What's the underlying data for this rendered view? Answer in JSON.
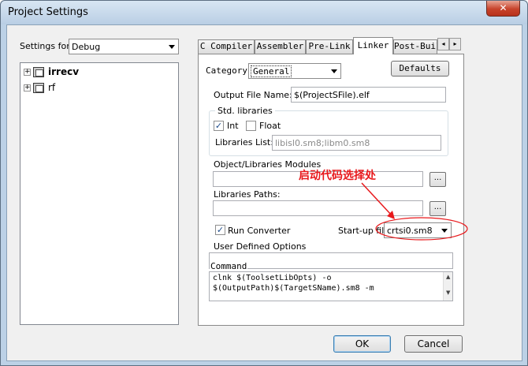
{
  "window": {
    "title": "Project Settings",
    "close_glyph": "✕"
  },
  "settings_for": {
    "label": "Settings for:",
    "value": "Debug"
  },
  "tree": {
    "items": [
      {
        "label": "irrecv",
        "expander": "+"
      },
      {
        "label": "rf",
        "expander": "+"
      }
    ]
  },
  "tabs": [
    {
      "label": "C Compiler"
    },
    {
      "label": "Assembler"
    },
    {
      "label": "Pre-Link"
    },
    {
      "label": "Linker"
    },
    {
      "label": "Post-Buil"
    }
  ],
  "tab_scroll": {
    "left": "◂",
    "right": "▸"
  },
  "linker": {
    "category_label": "Category",
    "category_value": "General",
    "defaults_button": "Defaults",
    "output_file_label": "Output File Name:",
    "output_file_value": "$(ProjectSFile).elf",
    "std_libraries_legend": "Std. libraries",
    "int_label": "Int",
    "int_checked": "✓",
    "float_label": "Float",
    "libraries_list_label": "Libraries List:",
    "libraries_list_value": "libisl0.sm8;libm0.sm8",
    "object_modules_label": "Object/Libraries Modules",
    "ellipsis_1": "...",
    "libraries_paths_label": "Libraries Paths:",
    "ellipsis_2": "...",
    "run_converter_label": "Run Converter",
    "run_converter_checked": "✓",
    "startup_file_label": "Start-up file:",
    "startup_file_value": "crtsi0.sm8",
    "user_options_label": "User Defined Options",
    "command_label": "Command",
    "command_lines": [
      "clnk $(ToolsetLibOpts) -o",
      "$(OutputPath)$(TargetSName).sm8 -m"
    ]
  },
  "annotation": {
    "text": "启动代码选择处",
    "color": "#e8191c"
  },
  "buttons": {
    "ok": "OK",
    "cancel": "Cancel"
  },
  "scroll_glyphs": {
    "up": "▲",
    "down": "▼"
  }
}
